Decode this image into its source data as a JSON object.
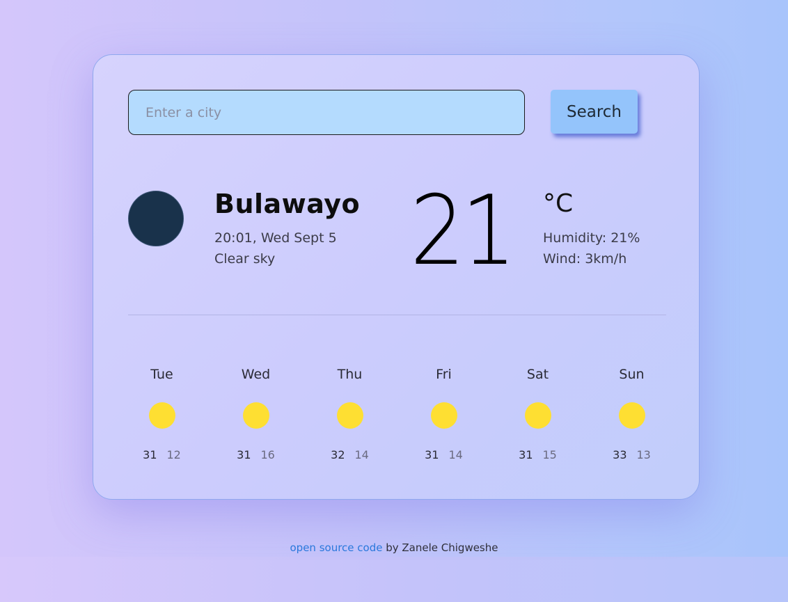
{
  "search": {
    "placeholder": "Enter a city",
    "value": "",
    "button_label": "Search"
  },
  "current": {
    "city": "Bulawayo",
    "datetime": "20:01, Wed Sept 5",
    "description": "Clear sky",
    "temperature": "21",
    "unit": "°C",
    "humidity": "Humidity: 21%",
    "wind": "Wind: 3km/h",
    "icon": "moon-icon"
  },
  "forecast": [
    {
      "day": "Tue",
      "max": "31",
      "min": "12",
      "icon": "sun-icon"
    },
    {
      "day": "Wed",
      "max": "31",
      "min": "16",
      "icon": "sun-icon"
    },
    {
      "day": "Thu",
      "max": "32",
      "min": "14",
      "icon": "sun-icon"
    },
    {
      "day": "Fri",
      "max": "31",
      "min": "14",
      "icon": "sun-icon"
    },
    {
      "day": "Sat",
      "max": "31",
      "min": "15",
      "icon": "sun-icon"
    },
    {
      "day": "Sun",
      "max": "33",
      "min": "13",
      "icon": "sun-icon"
    }
  ],
  "footer": {
    "link_text": "open source code",
    "suffix": " by Zanele Chigweshe"
  },
  "colors": {
    "card_bg": "#ccccfd",
    "input_bg": "#b4dbfe",
    "button_bg": "#94c4fb",
    "night_icon": "#19324b",
    "sun": "#fedf32",
    "link": "#2a78dc"
  }
}
